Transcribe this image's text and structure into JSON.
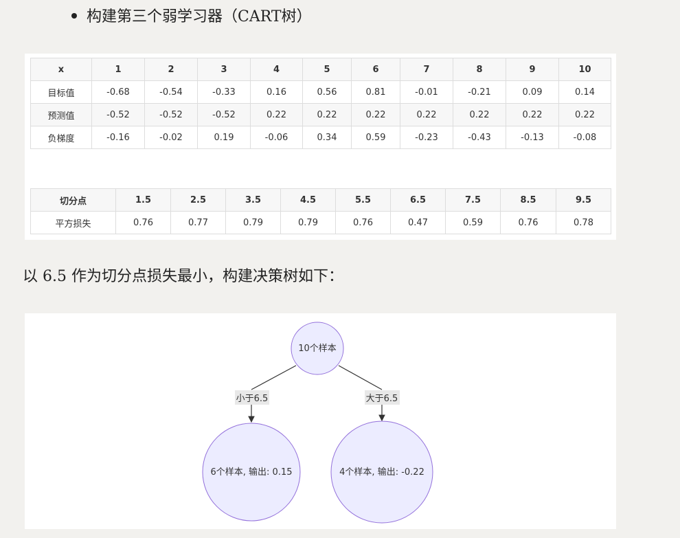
{
  "heading": "构建第三个弱学习器（CART树）",
  "table1": {
    "headers": [
      "x",
      "1",
      "2",
      "3",
      "4",
      "5",
      "6",
      "7",
      "8",
      "9",
      "10"
    ],
    "rows": [
      [
        "目标值",
        "-0.68",
        "-0.54",
        "-0.33",
        "0.16",
        "0.56",
        "0.81",
        "-0.01",
        "-0.21",
        "0.09",
        "0.14"
      ],
      [
        "预测值",
        "-0.52",
        "-0.52",
        "-0.52",
        "0.22",
        "0.22",
        "0.22",
        "0.22",
        "0.22",
        "0.22",
        "0.22"
      ],
      [
        "负梯度",
        "-0.16",
        "-0.02",
        "0.19",
        "-0.06",
        "0.34",
        "0.59",
        "-0.23",
        "-0.43",
        "-0.13",
        "-0.08"
      ]
    ]
  },
  "table2": {
    "headers": [
      "切分点",
      "1.5",
      "2.5",
      "3.5",
      "4.5",
      "5.5",
      "6.5",
      "7.5",
      "8.5",
      "9.5"
    ],
    "rows": [
      [
        "平方损失",
        "0.76",
        "0.77",
        "0.79",
        "0.79",
        "0.76",
        "0.47",
        "0.59",
        "0.76",
        "0.78"
      ]
    ]
  },
  "sentence": "以 6.5 作为切分点损失最小，构建决策树如下：",
  "tree": {
    "root": "10个样本",
    "left_edge": "小于6.5",
    "right_edge": "大于6.5",
    "left_leaf": "6个样本, 输出: 0.15",
    "right_leaf": "4个样本, 输出: -0.22",
    "node_fill": "#ececff",
    "node_stroke": "#9370db"
  }
}
